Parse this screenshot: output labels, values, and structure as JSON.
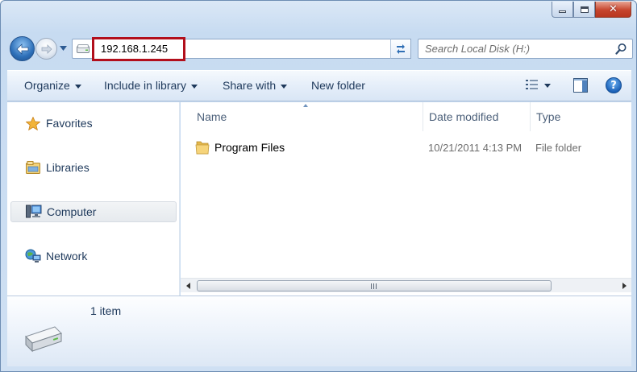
{
  "window": {
    "caption_buttons": [
      "minimize",
      "maximize",
      "close"
    ]
  },
  "nav": {
    "back_icon": "back-arrow-icon",
    "forward_icon": "forward-arrow-icon",
    "address": "192.168.1.245",
    "search_placeholder": "Search Local Disk (H:)"
  },
  "toolbar": {
    "organize": "Organize",
    "include_in_library": "Include in library",
    "share_with": "Share with",
    "new_folder": "New folder"
  },
  "sidebar": {
    "items": [
      {
        "label": "Favorites",
        "icon": "star-icon"
      },
      {
        "label": "Libraries",
        "icon": "libraries-icon"
      },
      {
        "label": "Computer",
        "icon": "computer-icon",
        "selected": true
      },
      {
        "label": "Network",
        "icon": "network-icon"
      }
    ]
  },
  "columns": {
    "name": "Name",
    "date_modified": "Date modified",
    "type": "Type"
  },
  "files": [
    {
      "name": "Program Files",
      "date_modified": "10/21/2011 4:13 PM",
      "type": "File folder",
      "icon": "folder-icon"
    }
  ],
  "details": {
    "item_count": "1 item",
    "icon": "drive-icon"
  },
  "colors": {
    "accent_highlight": "#b20f1c",
    "text_primary": "#1e395b",
    "chrome": "#c7dbf1"
  }
}
